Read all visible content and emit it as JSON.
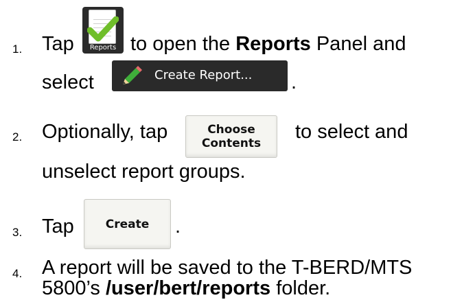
{
  "steps": [
    {
      "number": "1.",
      "line1_before": "Tap",
      "line1_after": "to open the",
      "line1_bold": "Reports",
      "line1_end": "Panel and",
      "line2": "select",
      "line2_end": "."
    },
    {
      "number": "2.",
      "line1_before": "Optionally, tap",
      "line1_after": "to select and",
      "line2": "unselect report groups."
    },
    {
      "number": "3.",
      "line1_before": "Tap",
      "line1_end": "."
    },
    {
      "number": "4.",
      "line1": "A report will be saved to the T-BERD/MTS",
      "line2_before": "5800’s",
      "line2_bold": "/user/bert/reports",
      "line2_after": "folder."
    }
  ],
  "buttons": {
    "reports_icon_label": "Reports",
    "create_report_label": "Create Report...",
    "choose_contents_line1": "Choose",
    "choose_contents_line2": "Contents",
    "create_label": "Create"
  },
  "colors": {
    "check_green": "#6fbe2a",
    "pencil_green": "#3fae3a",
    "dark_button": "#2a2a2a",
    "light_button": "#f5f5f1"
  }
}
